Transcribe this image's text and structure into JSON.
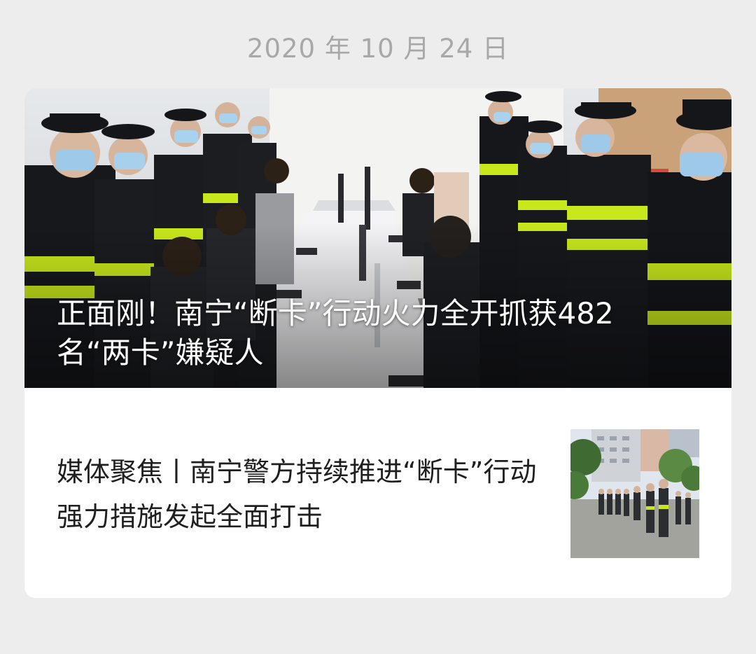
{
  "message": {
    "date": "2020 年 10 月 24 日"
  },
  "card": {
    "lead_article": {
      "title": "正面刚！南宁“断卡”行动火力全开抓获482 名“两卡”嫌疑人",
      "cover_image": "police-operation-photo"
    },
    "sub_article": {
      "title": "媒体聚焦丨南宁警方持续推进“断卡”行动 强力措施发起全面打击",
      "thumbnail_image": "police-lineup-street-photo"
    }
  },
  "colors": {
    "page_background": "#ededed",
    "card_background": "#ffffff",
    "date_text": "#a8a8a8",
    "title_text": "#1f1f1f",
    "overlay_text": "#ffffff",
    "reflective_vest": "#c8e81c"
  }
}
